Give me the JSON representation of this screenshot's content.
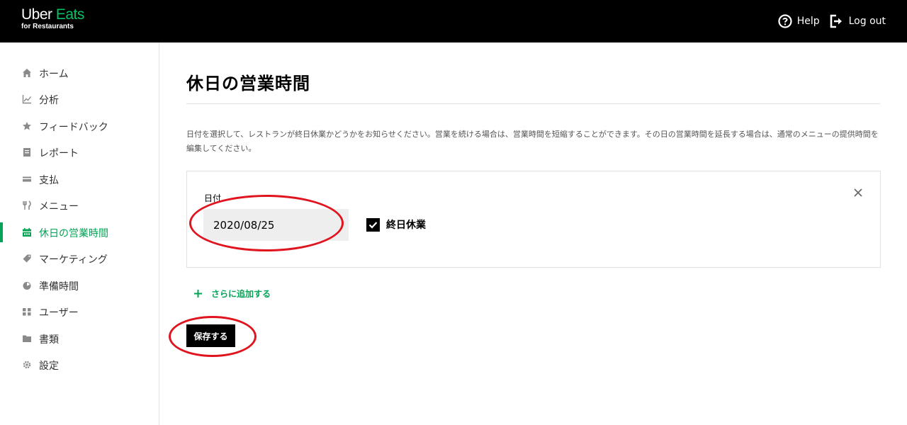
{
  "header": {
    "logo_primary": "Uber",
    "logo_accent": "Eats",
    "logo_sub": "for Restaurants",
    "help_label": "Help",
    "logout_label": "Log out",
    "brand_color": "#06c167"
  },
  "sidebar": {
    "items": [
      {
        "label": "ホーム",
        "icon": "home-icon"
      },
      {
        "label": "分析",
        "icon": "chart-icon"
      },
      {
        "label": "フィードバック",
        "icon": "star-icon"
      },
      {
        "label": "レポート",
        "icon": "report-icon"
      },
      {
        "label": "支払",
        "icon": "payment-icon"
      },
      {
        "label": "メニュー",
        "icon": "cutlery-icon"
      },
      {
        "label": "休日の営業時間",
        "icon": "calendar-icon",
        "active": true
      },
      {
        "label": "マーケティング",
        "icon": "tag-icon"
      },
      {
        "label": "準備時間",
        "icon": "timer-icon"
      },
      {
        "label": "ユーザー",
        "icon": "users-icon"
      },
      {
        "label": "書類",
        "icon": "folder-icon"
      },
      {
        "label": "設定",
        "icon": "gear-icon"
      }
    ],
    "active_color": "#05a357"
  },
  "main": {
    "title": "休日の営業時間",
    "description": "日付を選択して、レストランが終日休業かどうかをお知らせください。営業を続ける場合は、営業時間を短縮することができます。その日の営業時間を延長する場合は、通常のメニューの提供時間を編集してください。",
    "entry": {
      "date_label": "日付",
      "date_value": "2020/08/25",
      "closed_all_day_label": "終日休業",
      "closed_all_day_checked": true
    },
    "add_more_label": "さらに追加する",
    "save_label": "保存する"
  },
  "annotation_color": "#e0141e"
}
